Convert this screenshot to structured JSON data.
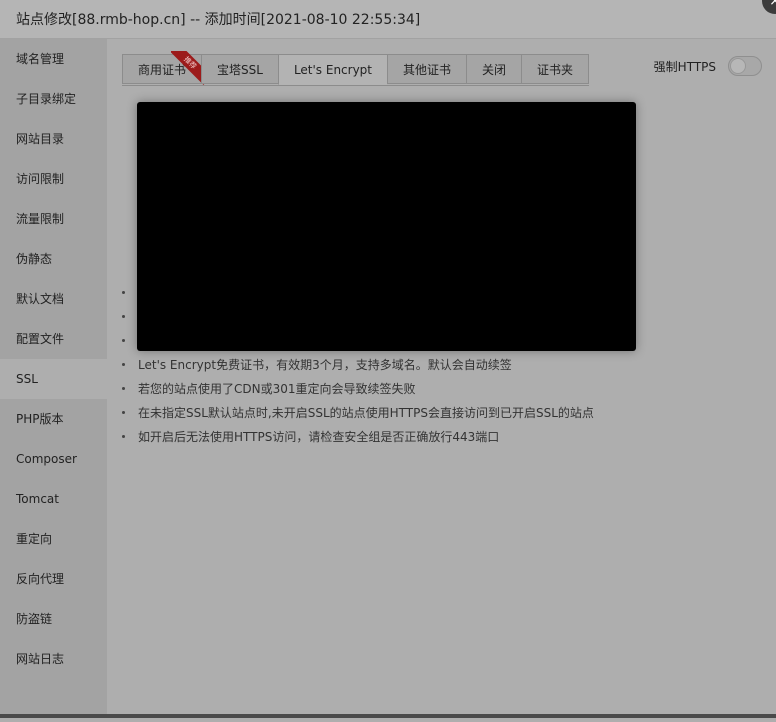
{
  "title": "站点修改[88.rmb-hop.cn] -- 添加时间[2021-08-10 22:55:34]",
  "close_icon": "×",
  "sidebar": {
    "items": [
      {
        "label": "域名管理"
      },
      {
        "label": "子目录绑定"
      },
      {
        "label": "网站目录"
      },
      {
        "label": "访问限制"
      },
      {
        "label": "流量限制"
      },
      {
        "label": "伪静态"
      },
      {
        "label": "默认文档"
      },
      {
        "label": "配置文件"
      },
      {
        "label": "SSL"
      },
      {
        "label": "PHP版本"
      },
      {
        "label": "Composer"
      },
      {
        "label": "Tomcat"
      },
      {
        "label": "重定向"
      },
      {
        "label": "反向代理"
      },
      {
        "label": "防盗链"
      },
      {
        "label": "网站日志"
      }
    ],
    "active_index": 8
  },
  "tabs": [
    {
      "label": "商用证书"
    },
    {
      "label": "宝塔SSL"
    },
    {
      "label": "Let's Encrypt"
    },
    {
      "label": "其他证书"
    },
    {
      "label": "关闭"
    },
    {
      "label": "证书夹"
    }
  ],
  "active_tab_index": 2,
  "recommend_badge": "推荐",
  "force_https": {
    "label": "强制HTTPS",
    "enabled": false
  },
  "tips": [
    {
      "text": ""
    },
    {
      "text": ""
    },
    {
      "text": ""
    },
    {
      "text": "Let's Encrypt免费证书，有效期3个月，支持多域名。默认会自动续签"
    },
    {
      "text": "若您的站点使用了CDN或301重定向会导致续签失败"
    },
    {
      "text": "在未指定SSL默认站点时,未开启SSL的站点使用HTTPS会直接访问到已开启SSL的站点"
    },
    {
      "text": "如开启后无法使用HTTPS访问，请检查安全组是否正确放行443端口"
    }
  ]
}
